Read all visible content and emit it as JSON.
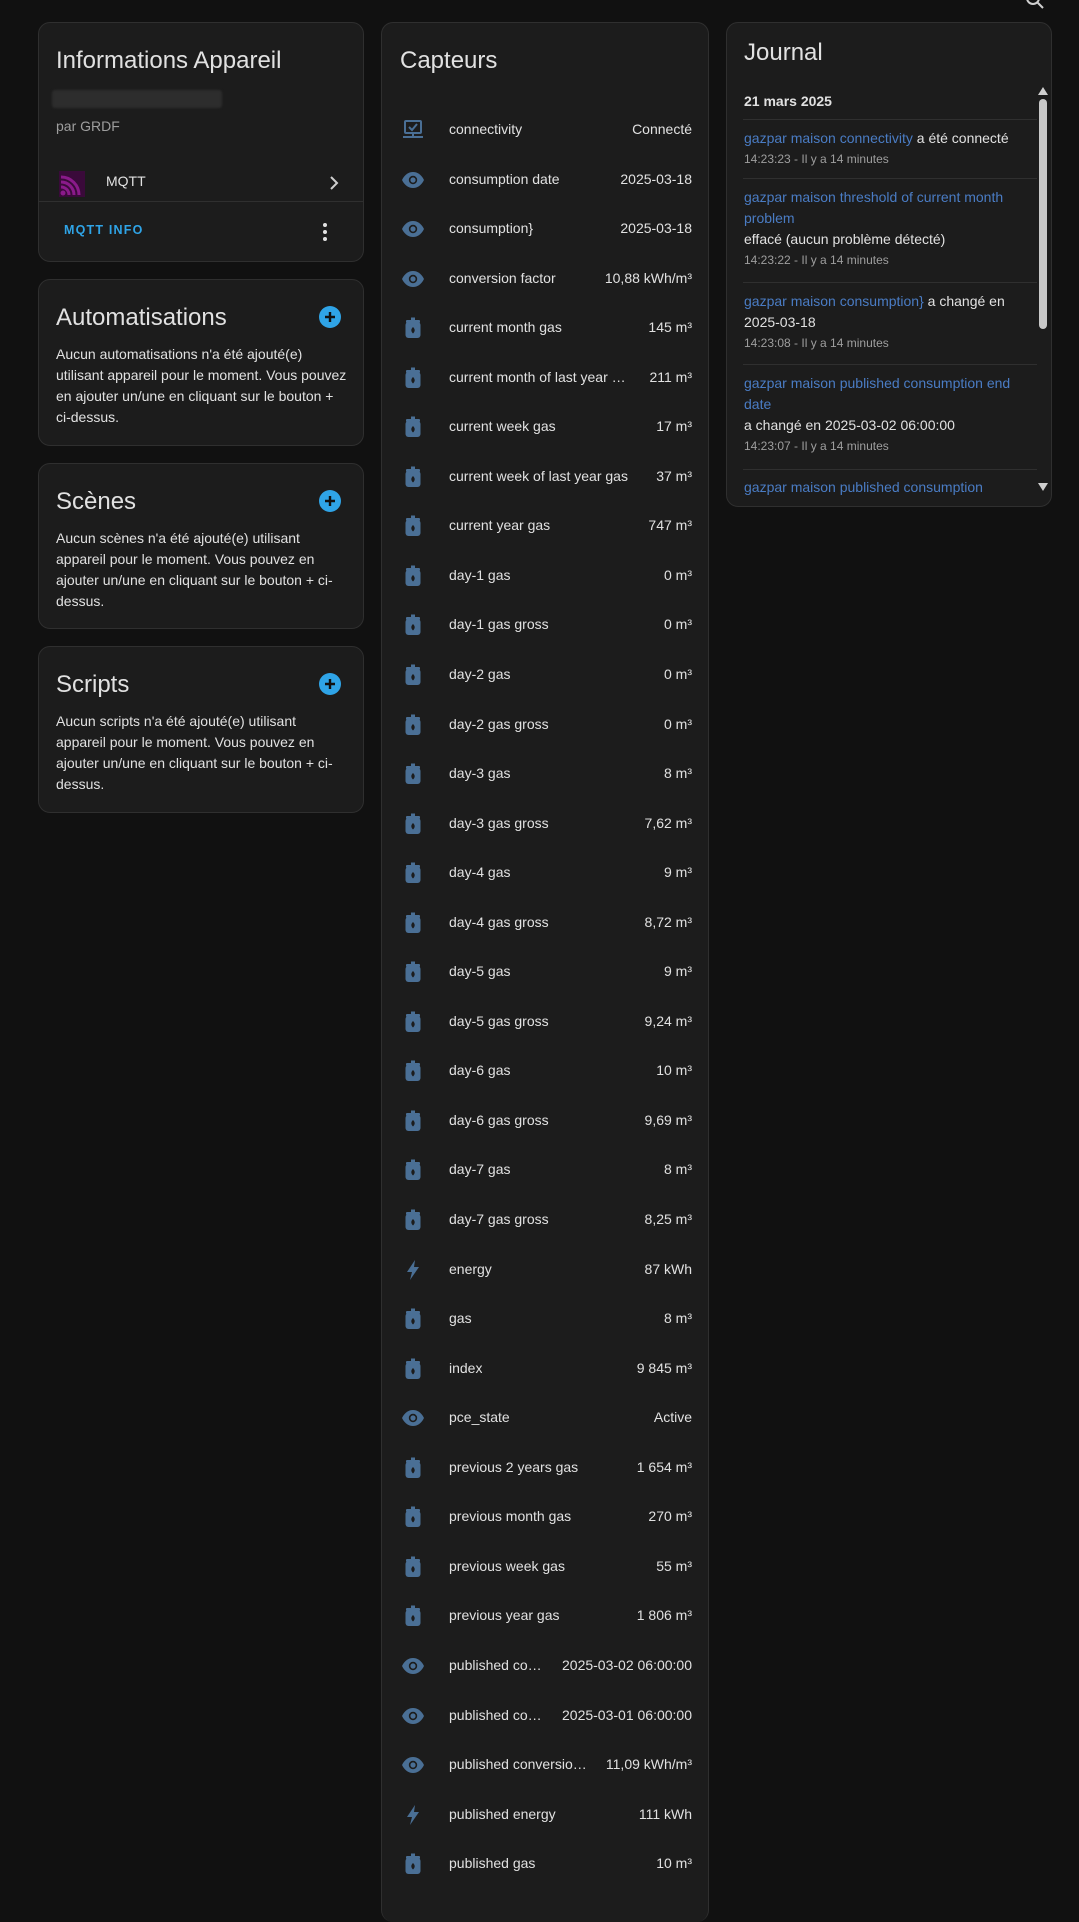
{
  "info": {
    "title": "Informations Appareil",
    "by": "par GRDF",
    "integration": "MQTT",
    "mqtt_info": "MQTT INFO"
  },
  "automations": {
    "title": "Automatisations",
    "text": "Aucun automatisations n'a été ajouté(e) utilisant appareil pour le moment. Vous pouvez en ajouter un/une en cliquant sur le bouton + ci-dessus."
  },
  "scenes": {
    "title": "Scènes",
    "text": "Aucun scènes n'a été ajouté(e) utilisant appareil pour le moment. Vous pouvez en ajouter un/une en cliquant sur le bouton + ci-dessus."
  },
  "scripts": {
    "title": "Scripts",
    "text": "Aucun scripts n'a été ajouté(e) utilisant appareil pour le moment. Vous pouvez en ajouter un/une en cliquant sur le bouton + ci-dessus."
  },
  "sensors": {
    "title": "Capteurs",
    "items": [
      {
        "name": "connectivity",
        "value": "Connecté",
        "icon": "monitor-check-icon"
      },
      {
        "name": "consumption date",
        "value": "2025-03-18",
        "icon": "eye-icon"
      },
      {
        "name": "consumption}",
        "value": "2025-03-18",
        "icon": "eye-icon"
      },
      {
        "name": "conversion factor",
        "value": "10,88 kWh/m³",
        "icon": "eye-icon"
      },
      {
        "name": "current month gas",
        "value": "145 m³",
        "icon": "gas-cylinder-icon"
      },
      {
        "name": "current month of last year …",
        "value": "211 m³",
        "icon": "gas-cylinder-icon"
      },
      {
        "name": "current week gas",
        "value": "17 m³",
        "icon": "gas-cylinder-icon"
      },
      {
        "name": "current week of last year gas",
        "value": "37 m³",
        "icon": "gas-cylinder-icon"
      },
      {
        "name": "current year gas",
        "value": "747 m³",
        "icon": "gas-cylinder-icon"
      },
      {
        "name": "day-1 gas",
        "value": "0 m³",
        "icon": "gas-cylinder-icon"
      },
      {
        "name": "day-1 gas gross",
        "value": "0 m³",
        "icon": "gas-cylinder-icon"
      },
      {
        "name": "day-2 gas",
        "value": "0 m³",
        "icon": "gas-cylinder-icon"
      },
      {
        "name": "day-2 gas gross",
        "value": "0 m³",
        "icon": "gas-cylinder-icon"
      },
      {
        "name": "day-3 gas",
        "value": "8 m³",
        "icon": "gas-cylinder-icon"
      },
      {
        "name": "day-3 gas gross",
        "value": "7,62 m³",
        "icon": "gas-cylinder-icon"
      },
      {
        "name": "day-4 gas",
        "value": "9 m³",
        "icon": "gas-cylinder-icon"
      },
      {
        "name": "day-4 gas gross",
        "value": "8,72 m³",
        "icon": "gas-cylinder-icon"
      },
      {
        "name": "day-5 gas",
        "value": "9 m³",
        "icon": "gas-cylinder-icon"
      },
      {
        "name": "day-5 gas gross",
        "value": "9,24 m³",
        "icon": "gas-cylinder-icon"
      },
      {
        "name": "day-6 gas",
        "value": "10 m³",
        "icon": "gas-cylinder-icon"
      },
      {
        "name": "day-6 gas gross",
        "value": "9,69 m³",
        "icon": "gas-cylinder-icon"
      },
      {
        "name": "day-7 gas",
        "value": "8 m³",
        "icon": "gas-cylinder-icon"
      },
      {
        "name": "day-7 gas gross",
        "value": "8,25 m³",
        "icon": "gas-cylinder-icon"
      },
      {
        "name": "energy",
        "value": "87 kWh",
        "icon": "lightning-icon"
      },
      {
        "name": "gas",
        "value": "8 m³",
        "icon": "gas-cylinder-icon"
      },
      {
        "name": "index",
        "value": "9 845 m³",
        "icon": "gas-cylinder-icon"
      },
      {
        "name": "pce_state",
        "value": "Active",
        "icon": "eye-icon"
      },
      {
        "name": "previous 2 years gas",
        "value": "1 654 m³",
        "icon": "gas-cylinder-icon"
      },
      {
        "name": "previous month gas",
        "value": "270 m³",
        "icon": "gas-cylinder-icon"
      },
      {
        "name": "previous week gas",
        "value": "55 m³",
        "icon": "gas-cylinder-icon"
      },
      {
        "name": "previous year gas",
        "value": "1 806 m³",
        "icon": "gas-cylinder-icon"
      },
      {
        "name": "published co…",
        "value": "2025-03-02 06:00:00",
        "icon": "eye-icon"
      },
      {
        "name": "published co…",
        "value": "2025-03-01 06:00:00",
        "icon": "eye-icon"
      },
      {
        "name": "published conversio…",
        "value": "11,09 kWh/m³",
        "icon": "eye-icon"
      },
      {
        "name": "published energy",
        "value": "111 kWh",
        "icon": "lightning-icon"
      },
      {
        "name": "published gas",
        "value": "10 m³",
        "icon": "gas-cylinder-icon"
      }
    ]
  },
  "journal": {
    "title": "Journal",
    "date": "21 mars 2025",
    "entries": [
      {
        "entity": "gazpar maison connectivity",
        "message": " a été connecté",
        "time": "14:23:23 - Il y a 14 minutes"
      },
      {
        "entity": "gazpar maison threshold of current month problem",
        "message": "effacé (aucun problème détecté)",
        "time": "14:23:22 - Il y a 14 minutes"
      },
      {
        "entity": "gazpar maison consumption}",
        "message": " a changé en 2025-03-18",
        "time": "14:23:08 - Il y a 14 minutes"
      },
      {
        "entity": "gazpar maison published consumption end date",
        "message": "a changé en 2025-03-02 06:00:00",
        "time": "14:23:07 - Il y a 14 minutes"
      },
      {
        "entity": "gazpar maison published consumption",
        "message": "",
        "time": ""
      }
    ]
  },
  "colors": {
    "background": "#111111",
    "card": "#1c1c1c",
    "accent": "#2fa4e7",
    "icon": "#4a6f95",
    "entity_link": "#4a7cc4"
  }
}
